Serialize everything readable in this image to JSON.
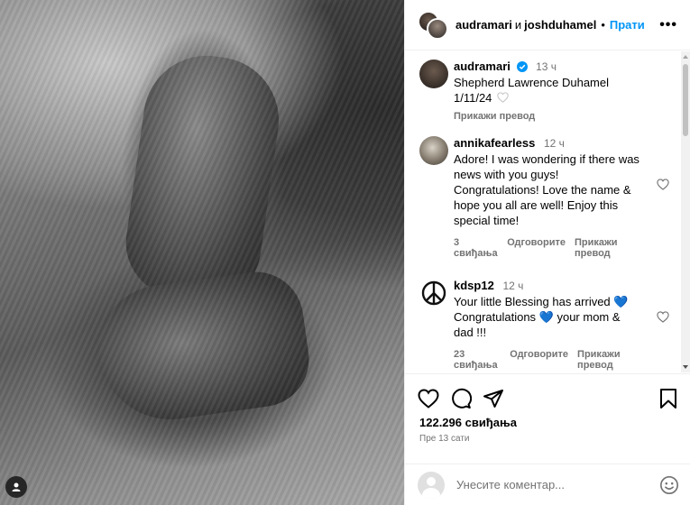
{
  "header": {
    "user1": "audramari",
    "conjunction": "и",
    "user2": "joshduhamel",
    "separator": "•",
    "follow_label": "Прати",
    "more_label": "•••"
  },
  "comments": [
    {
      "user": "audramari",
      "verified": true,
      "time": "13 ч",
      "lines": [
        "Shepherd Lawrence Duhamel",
        "1/11/24"
      ],
      "meta": [
        "Прикажи превод"
      ]
    },
    {
      "user": "annikafearless",
      "verified": false,
      "time": "12 ч",
      "lines": [
        "Adore! I was wondering if there was",
        "news with you guys!",
        "Congratulations! Love the name &",
        "hope you all are well! Enjoy this",
        "special time!"
      ],
      "meta": [
        "3 свиђања",
        "Одговорите",
        "Прикажи превод"
      ]
    },
    {
      "user": "kdsp12",
      "verified": false,
      "time": "12 ч",
      "lines": [
        "Your little Blessing has arrived 💙",
        "Congratulations 💙 your mom &",
        "dad !!!"
      ],
      "meta": [
        "23 свиђања",
        "Одговорите",
        "Прикажи превод"
      ]
    }
  ],
  "likes": "122.296 свиђања",
  "post_time": "Пре 13 сати",
  "add_comment": {
    "placeholder": "Унесите коментар..."
  },
  "colors": {
    "accent": "#0095f6",
    "verified": "#0095f6",
    "muted": "#737373"
  },
  "icons": [
    "heart-icon",
    "comment-icon",
    "share-icon",
    "bookmark-icon",
    "emoji-icon",
    "verified-badge-icon",
    "peace-sign-icon",
    "more-options-icon"
  ]
}
